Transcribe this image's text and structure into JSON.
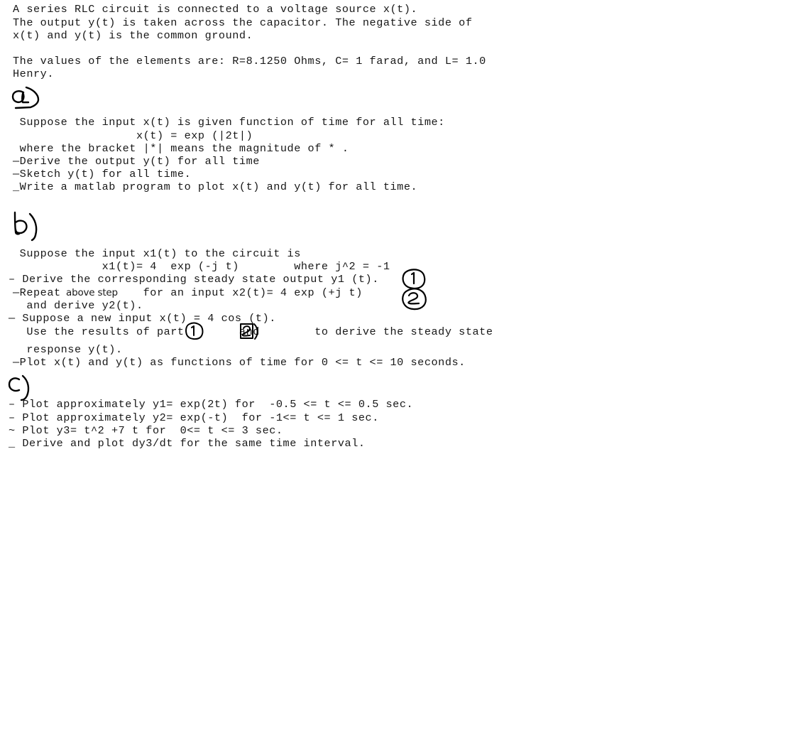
{
  "document": {
    "kind": "scanned-problem-sheet",
    "background_color": "#ffffff",
    "text_color": "#171717",
    "ink_color": "#000000"
  },
  "intro": {
    "lines": [
      "A series RLC circuit is connected to a voltage source x(t).",
      "The output y(t) is taken across the capacitor. The negative side of",
      "x(t) and y(t) is the common ground."
    ],
    "values_lines": [
      "The values of the elements are: R=8.1250 Ohms, C= 1 farad, and L= 1.0",
      "Henry."
    ],
    "element_values": {
      "resistance": "R=8.1250 Ohms",
      "capacitance": "C= 1 farad",
      "inductance": "L= 1.0 Henry"
    }
  },
  "sections": {
    "a": {
      "handwritten_label": "a)",
      "lines": [
        " Suppose the input x(t) is given function of time for all time:",
        "                  x(t) = exp (|2t|)",
        " where the bracket |*| means the magnitude of * .",
        "—Derive the output y(t) for all time",
        "—Sketch y(t) for all time.",
        "_Write a matlab program to plot x(t) and y(t) for all time."
      ],
      "equation": "x(t) = exp (|2t|)"
    },
    "b": {
      "handwritten_label": "b)",
      "lines": [
        " Suppose the input x1(t) to the circuit is",
        "             x1(t)= 4  exp (-j t)        where j^2 = -1",
        "– Derive the corresponding steady state output y1 (t).",
        "—Repeat            for an input x2(t)= 4 exp (+j t)",
        "  and derive y2(t).",
        "— Suppose a new input x(t) = 4 cos (t).",
        "  Use the results of part        and        to derive the steady state",
        "  response y(t).",
        "—Plot x(t) and y(t) as functions of time for 0 <= t <= 10 seconds."
      ],
      "inserted_text": "above step",
      "equation_x1": "x1(t)= 4  exp (-j t)",
      "condition": "where j^2 = -1",
      "equation_x2": "x2(t)= 4 exp (+j t)",
      "equation_new_input": "x(t) = 4 cos (t)",
      "plot_range": "0 <= t <= 10 seconds",
      "use_part_prefix": "  Use the results of part",
      "use_part_middle": "and",
      "use_part_suffix": "to derive the steady state"
    },
    "c": {
      "handwritten_label": "c)",
      "lines": [
        "– Plot approximately y1= exp(2t) for  -0.5 <= t <= 0.5 sec.",
        "– Plot approximately y2= exp(-t)  for -1<= t <= 1 sec.",
        "~ Plot y3= t^2 +7 t for  0<= t <= 3 sec.",
        "_ Derive and plot dy3/dt for the same time interval."
      ],
      "plots": [
        {
          "name": "y1",
          "expression": "exp(2t)",
          "range": "-0.5 <= t <= 0.5 sec."
        },
        {
          "name": "y2",
          "expression": "exp(-t)",
          "range": "-1<= t <= 1 sec."
        },
        {
          "name": "y3",
          "expression": "t^2 +7 t",
          "range": "0<= t <= 3 sec."
        },
        {
          "name": "dy3/dt",
          "expression": "derivative of y3",
          "range": "the same time interval."
        }
      ]
    }
  },
  "annotations": {
    "margin_circled_1": "1",
    "margin_circled_2": "2",
    "inline_circled_1": "1",
    "inline_circled_2": "2"
  }
}
